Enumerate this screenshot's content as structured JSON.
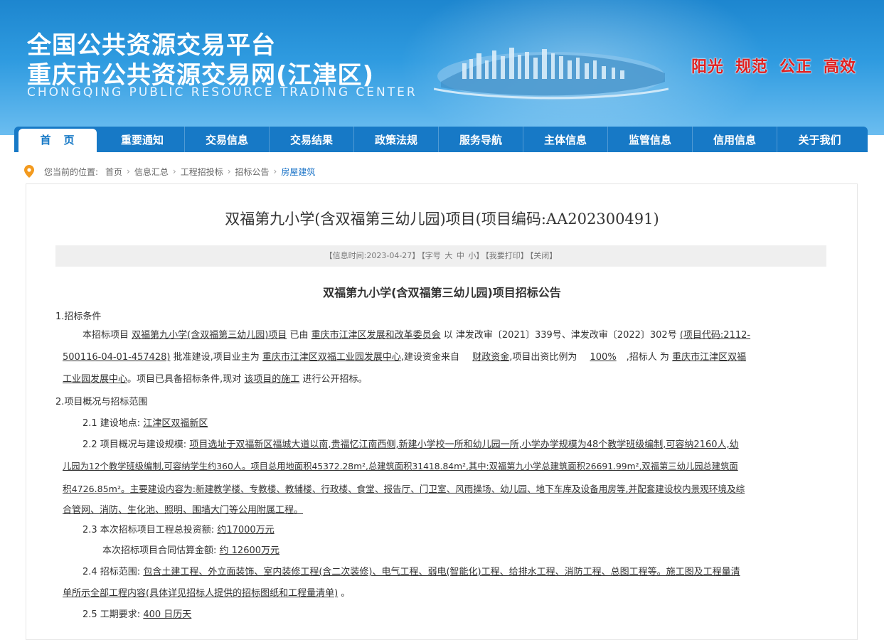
{
  "header": {
    "title_line1": "全国公共资源交易平台",
    "title_line2": "重庆市公共资源交易网(江津区)",
    "title_en": "CHONGQING PUBLIC RESOURCE TRADING CENTER",
    "slogans": [
      "阳光",
      "规范",
      "公正",
      "高效"
    ]
  },
  "nav": {
    "items": [
      "首页",
      "重要通知",
      "交易信息",
      "交易结果",
      "政策法规",
      "服务导航",
      "主体信息",
      "监管信息",
      "信用信息",
      "关于我们"
    ]
  },
  "breadcrumb": {
    "prefix": "您当前的位置:",
    "items": [
      "首页",
      "信息汇总",
      "工程招投标",
      "招标公告",
      "房屋建筑"
    ],
    "separator": "›"
  },
  "article": {
    "title": "双福第九小学(含双福第三幼儿园)项目(项目编码:AA202300491)",
    "info": {
      "time_label": "【信息时间:2023-04-27】",
      "font_label": "【字号",
      "font_large": "大",
      "font_mid": "中",
      "font_small": "小】",
      "print": "【我要打印】",
      "close": "【关闭】"
    },
    "notice_title": "双福第九小学(含双福第三幼儿园)项目招标公告",
    "s1_head": "1.招标条件",
    "s1_a": "本招标项目",
    "s1_b": "双福第九小学(含双福第三幼儿园)项目",
    "s1_c": "已由",
    "s1_d": "重庆市江津区发展和改革委员会",
    "s1_e": "以 津发改审〔2021〕339号、津发改审〔2022〕302号",
    "s1_f": "(项目代码:2112-",
    "s1_g": "500116-04-01-457428)",
    "s1_h": "批准建设,项目业主为",
    "s1_i": "重庆市江津区双福工业园发展中心",
    "s1_j": ",建设资金来自",
    "s1_k": "财政资金",
    "s1_l": ",项目出资比例为",
    "s1_m": "100%",
    "s1_n": ",招标人 为",
    "s1_o": "重庆市江津区双福",
    "s1_p": "工业园发展中心",
    "s1_q": "。项目已具备招标条件,现对",
    "s1_r": "该项目的施工",
    "s1_s": "进行公开招标。",
    "s2_head": "2.项目概况与招标范围",
    "s21_label": "2.1 建设地点:",
    "s21_val": "江津区双福新区",
    "s22_label": "2.2 项目概况与建设规模:",
    "s22_l1": "项目选址于双福新区福城大道以南,贵福忆江南西侧,新建小学校一所和幼儿园一所,小学办学规模为48个教学班级编制,可容纳2160人,幼",
    "s22_l2": "儿园为12个教学班级编制,可容纳学生约360人。项目总用地面积45372.28m²,总建筑面积31418.84m²,其中:双福第九小学总建筑面积26691.99m²,双福第三幼儿园总建筑面",
    "s22_l3": "积4726.85m²。主要建设内容为:新建教学楼、专教楼、教辅楼、行政楼、食堂、报告厅、门卫室、风雨操场、幼儿园、地下车库及设备用房等,并配套建设校内景观环境及综",
    "s22_l4": "合管网、消防、生化池、照明、围墙大门等公用附属工程。",
    "s23_label": "2.3 本次招标项目工程总投资额:",
    "s23_val": "约17000万元",
    "s23b_label": "本次招标项目合同估算金额:",
    "s23b_val": "约 12600万元",
    "s24_label": "2.4 招标范围:",
    "s24_l1": "包含土建工程、外立面装饰、室内装修工程(含二次装修)、电气工程、弱电(智能化)工程、给排水工程、消防工程、总图工程等。施工图及工程量清",
    "s24_l2": "单所示全部工程内容(具体详见招标人提供的招标图纸和工程量清单)",
    "s24_end": "。",
    "s25_label": "2.5 工期要求:",
    "s25_val": "400 日历天"
  },
  "colors": {
    "nav_bg": "#1779c6",
    "slogan": "#e02020",
    "link": "#1a73c7"
  }
}
